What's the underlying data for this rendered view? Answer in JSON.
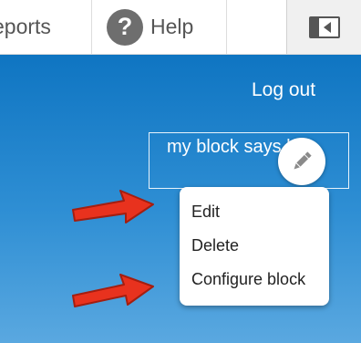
{
  "toolbar": {
    "reports_label": "eports",
    "help_icon_glyph": "?",
    "help_label": "Help",
    "toggle_icon": "sidebar-toggle-icon"
  },
  "header": {
    "logout_label": "Log out",
    "block_text": "my block says hi",
    "edit_icon": "pencil-icon"
  },
  "contextual_menu": {
    "items": [
      {
        "label": "Edit"
      },
      {
        "label": "Delete"
      },
      {
        "label": "Configure block"
      }
    ]
  },
  "colors": {
    "header_top": "#0f75c2",
    "header_bottom": "#5aa8e0",
    "annotation_arrow": "#e8321e",
    "toolbar_text": "#555555"
  },
  "annotations": {
    "arrow_icon": "red-arrow-icon"
  }
}
